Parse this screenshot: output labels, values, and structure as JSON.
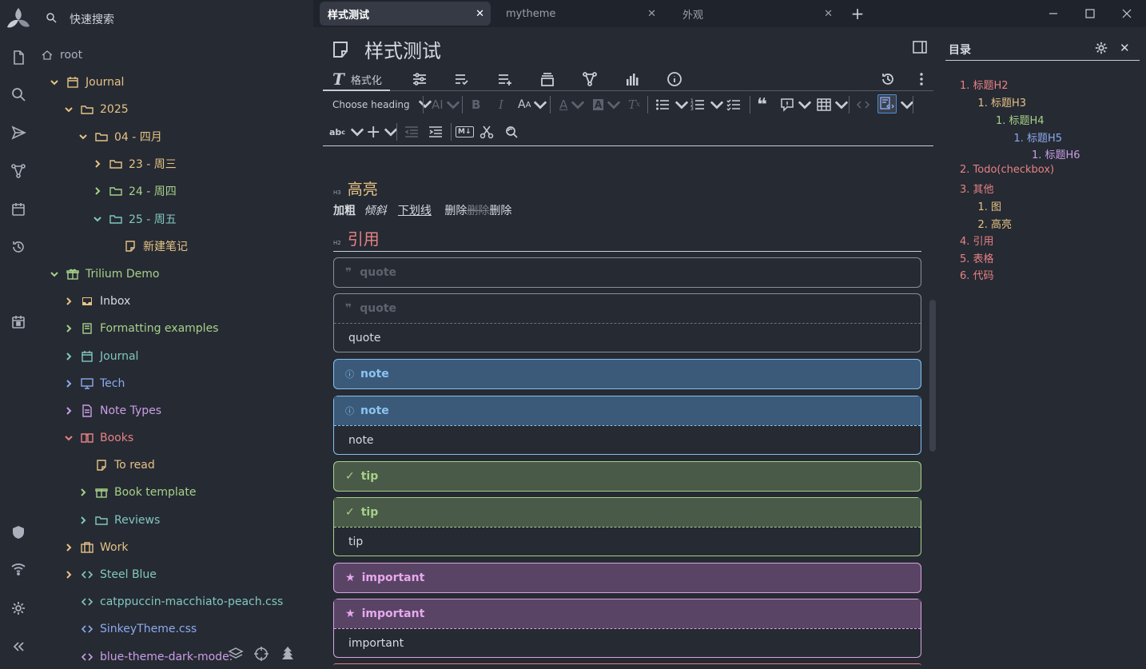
{
  "colors": {
    "bg": "#262a33",
    "tabbar": "#1f232b",
    "accent_yellow": "#e6c384",
    "green": "#a6d189",
    "teal": "#81c8be",
    "blue": "#8caaee",
    "pink": "#f4b8e4",
    "red": "#e78284",
    "lavender": "#babbf1"
  },
  "launcher": {
    "items": [
      "logo-icon",
      "note-icon",
      "search-icon",
      "send-icon",
      "graph-icon",
      "calendar-icon",
      "history-icon",
      "today-icon",
      "shield-icon",
      "wifi-icon",
      "settings-icon",
      "collapse-icon"
    ]
  },
  "tree": {
    "search_label": "快速搜索",
    "root": "root",
    "journal": "Journal",
    "year": "2025",
    "month": "04 - 四月",
    "day23": "23 - 周三",
    "day24": "24 - 周四",
    "day25": "25 - 周五",
    "new_note": "新建笔记",
    "demo": "Trilium Demo",
    "inbox": "Inbox",
    "formatting": "Formatting examples",
    "journal2": "Journal",
    "tech": "Tech",
    "note_types": "Note Types",
    "books": "Books",
    "to_read": "To read",
    "book_template": "Book template",
    "reviews": "Reviews",
    "work": "Work",
    "steel_blue": "Steel Blue",
    "catppuccin": "catppuccin-macchiato-peach.css",
    "sinkey": "SinkeyTheme.css",
    "blue_theme": "blue-theme-dark-mode."
  },
  "tabs": [
    {
      "label": "样式测试",
      "active": true
    },
    {
      "label": "mytheme",
      "active": false
    },
    {
      "label": "外观",
      "active": false
    }
  ],
  "note": {
    "title": "样式测试",
    "ribbon_format_label": "格式化",
    "heading_select": "Choose heading",
    "h3_marker": "H3",
    "h3_text": "高亮",
    "bold": "加粗",
    "italic": "倾斜",
    "underline": "下划线",
    "strike_a": "删除",
    "strike_b": "删除",
    "strike_c": "删除",
    "h2_marker": "H2",
    "h2_text": "引用",
    "quote_placeholder_1": "quote",
    "quote_placeholder_2": "quote",
    "quote_body": "quote",
    "note_head_1": "note",
    "note_head_2": "note",
    "note_body": "note",
    "tip_head_1": "tip",
    "tip_head_2": "tip",
    "tip_body": "tip",
    "important_head_1": "important",
    "important_head_2": "important",
    "important_body": "important"
  },
  "toc": {
    "title": "目录",
    "items": [
      {
        "text": "1. 标题H2",
        "level": 0,
        "color": "#e78284"
      },
      {
        "text": "1. 标题H3",
        "level": 1,
        "color": "#e6c384"
      },
      {
        "text": "1. 标题H4",
        "level": 2,
        "color": "#a6d189"
      },
      {
        "text": "1. 标题H5",
        "level": 3,
        "color": "#8caaee"
      },
      {
        "text": "1. 标题H6",
        "level": 4,
        "color": "#ca9ee6"
      },
      {
        "text": "2. Todo(checkbox)",
        "level": 0,
        "color": "#e78284"
      },
      {
        "text": "3. 其他",
        "level": 0,
        "color": "#e78284"
      },
      {
        "text": "1. 图",
        "level": 1,
        "color": "#e6c384"
      },
      {
        "text": "2. 高亮",
        "level": 1,
        "color": "#e6c384"
      },
      {
        "text": "4. 引用",
        "level": 0,
        "color": "#e78284"
      },
      {
        "text": "5. 表格",
        "level": 0,
        "color": "#e78284"
      },
      {
        "text": "6. 代码",
        "level": 0,
        "color": "#e78284"
      }
    ]
  }
}
